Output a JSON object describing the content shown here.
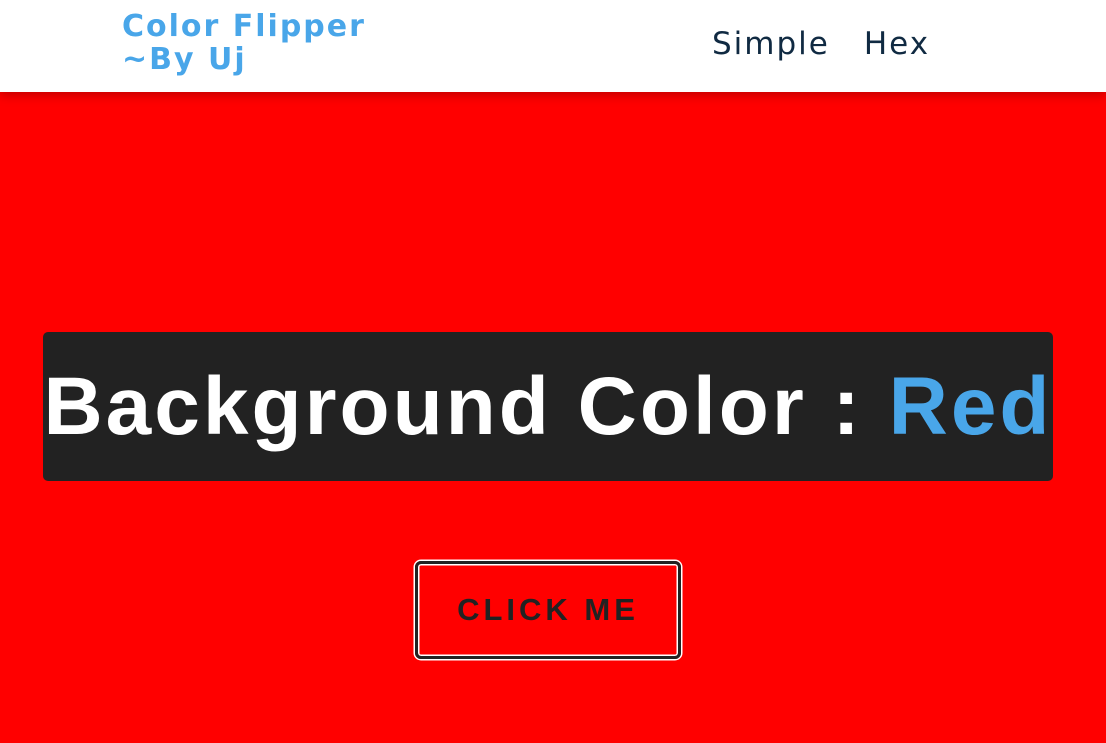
{
  "navbar": {
    "brand_line1": "Color Flipper",
    "brand_line2": "~By Uj",
    "links": [
      {
        "label": "Simple"
      },
      {
        "label": "Hex"
      }
    ]
  },
  "main": {
    "heading_prefix": "Background Color : ",
    "color_name": "Red",
    "button_label": "CLICK ME"
  },
  "colors": {
    "background": "#ff0000",
    "brand": "#49a6e9",
    "nav_text": "#102a42",
    "panel": "#222222",
    "heading_text": "#ffffff",
    "color_value": "#49a6e9"
  }
}
